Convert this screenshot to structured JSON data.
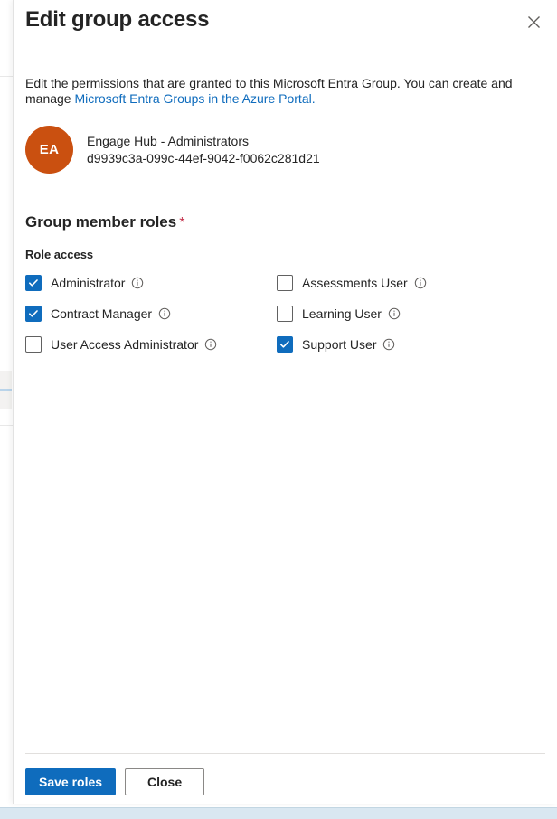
{
  "panel": {
    "title": "Edit group access",
    "close_icon": "close-icon",
    "description": {
      "text_before": "Edit the permissions that are granted to this Microsoft Entra Group. You can create and manage ",
      "link_text": "Microsoft Entra Groups in the Azure Portal.",
      "link_color": "#0f6cbd"
    },
    "group": {
      "avatar_initials": "EA",
      "avatar_color": "#ca5010",
      "name": "Engage Hub - Administrators",
      "id": "d9939c3a-099c-44ef-9042-f0062c281d21"
    },
    "roles_section": {
      "title": "Group member roles",
      "required_marker": "*",
      "required_color": "#c4314b",
      "subsection_title": "Role access",
      "items": [
        {
          "label": "Administrator",
          "checked": true,
          "info_icon": "info-icon",
          "column": 1
        },
        {
          "label": "Assessments User",
          "checked": false,
          "info_icon": "info-icon",
          "column": 2
        },
        {
          "label": "Contract Manager",
          "checked": true,
          "info_icon": "info-icon",
          "column": 1
        },
        {
          "label": "Learning User",
          "checked": false,
          "info_icon": "info-icon",
          "column": 2
        },
        {
          "label": "User Access Administrator",
          "checked": false,
          "info_icon": "info-icon",
          "column": 1
        },
        {
          "label": "Support User",
          "checked": true,
          "info_icon": "info-icon",
          "column": 2
        }
      ],
      "checked_color": "#0f6cbd"
    },
    "footer": {
      "save_label": "Save roles",
      "close_label": "Close"
    }
  }
}
